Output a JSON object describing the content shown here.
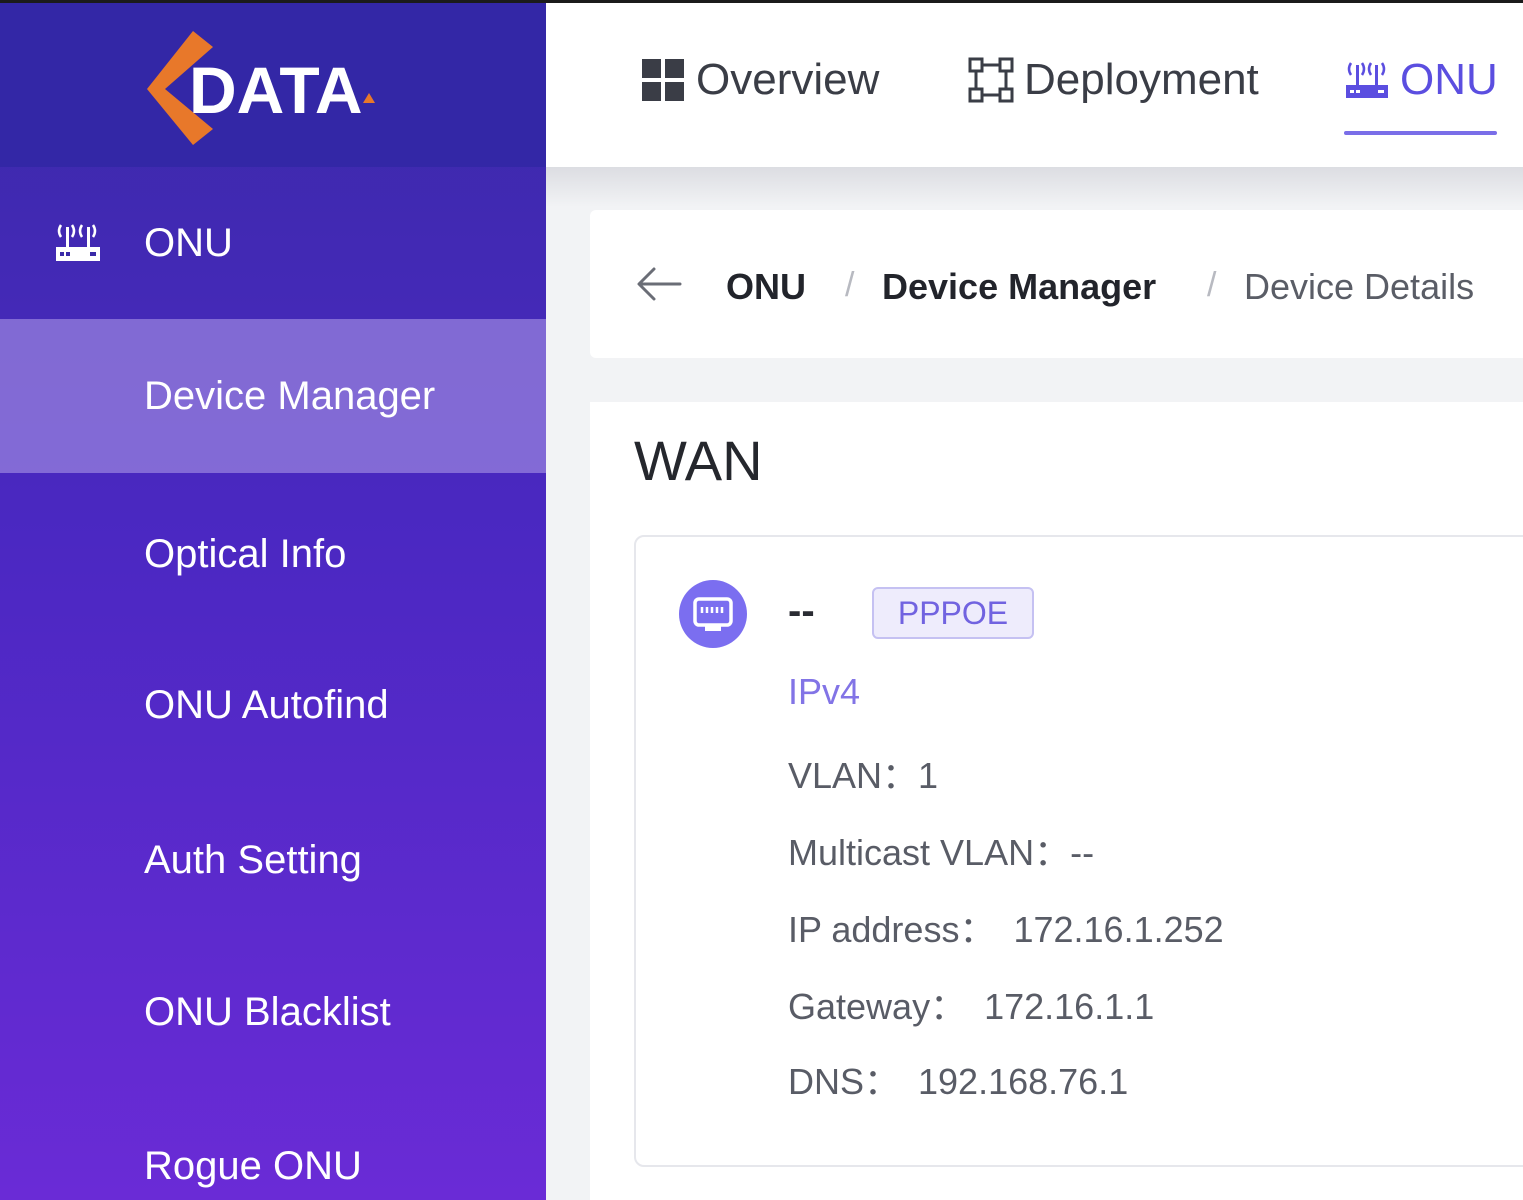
{
  "brand": {
    "logo_text": "DATA",
    "accent": "#e8782a",
    "primary": "#3a2aa8"
  },
  "sidebar": {
    "group": {
      "label": "ONU",
      "icon": "router-icon"
    },
    "items": [
      {
        "label": "Device Manager",
        "active": true
      },
      {
        "label": "Optical Info"
      },
      {
        "label": "ONU Autofind"
      },
      {
        "label": "Auth Setting"
      },
      {
        "label": "ONU Blacklist"
      },
      {
        "label": "Rogue ONU"
      }
    ]
  },
  "header": {
    "tabs": [
      {
        "label": "Overview",
        "icon": "dashboard-grid-icon"
      },
      {
        "label": "Deployment",
        "icon": "topology-icon"
      },
      {
        "label": "ONU",
        "icon": "router-icon",
        "active": true
      }
    ]
  },
  "breadcrumb": {
    "items": [
      "ONU",
      "Device Manager",
      "Device Details"
    ],
    "separator": "/"
  },
  "wan": {
    "title": "WAN",
    "connection": {
      "name": "--",
      "type_tag": "PPPOE",
      "protocol": "IPv4",
      "fields": [
        {
          "label": "VLAN：",
          "value": "1"
        },
        {
          "label": "Multicast VLAN：",
          "value": "--"
        },
        {
          "label": "IP address：",
          "value": "172.16.1.252"
        },
        {
          "label": "Gateway：",
          "value": "172.16.1.1"
        },
        {
          "label": "DNS：",
          "value": "192.168.76.1"
        }
      ]
    }
  }
}
